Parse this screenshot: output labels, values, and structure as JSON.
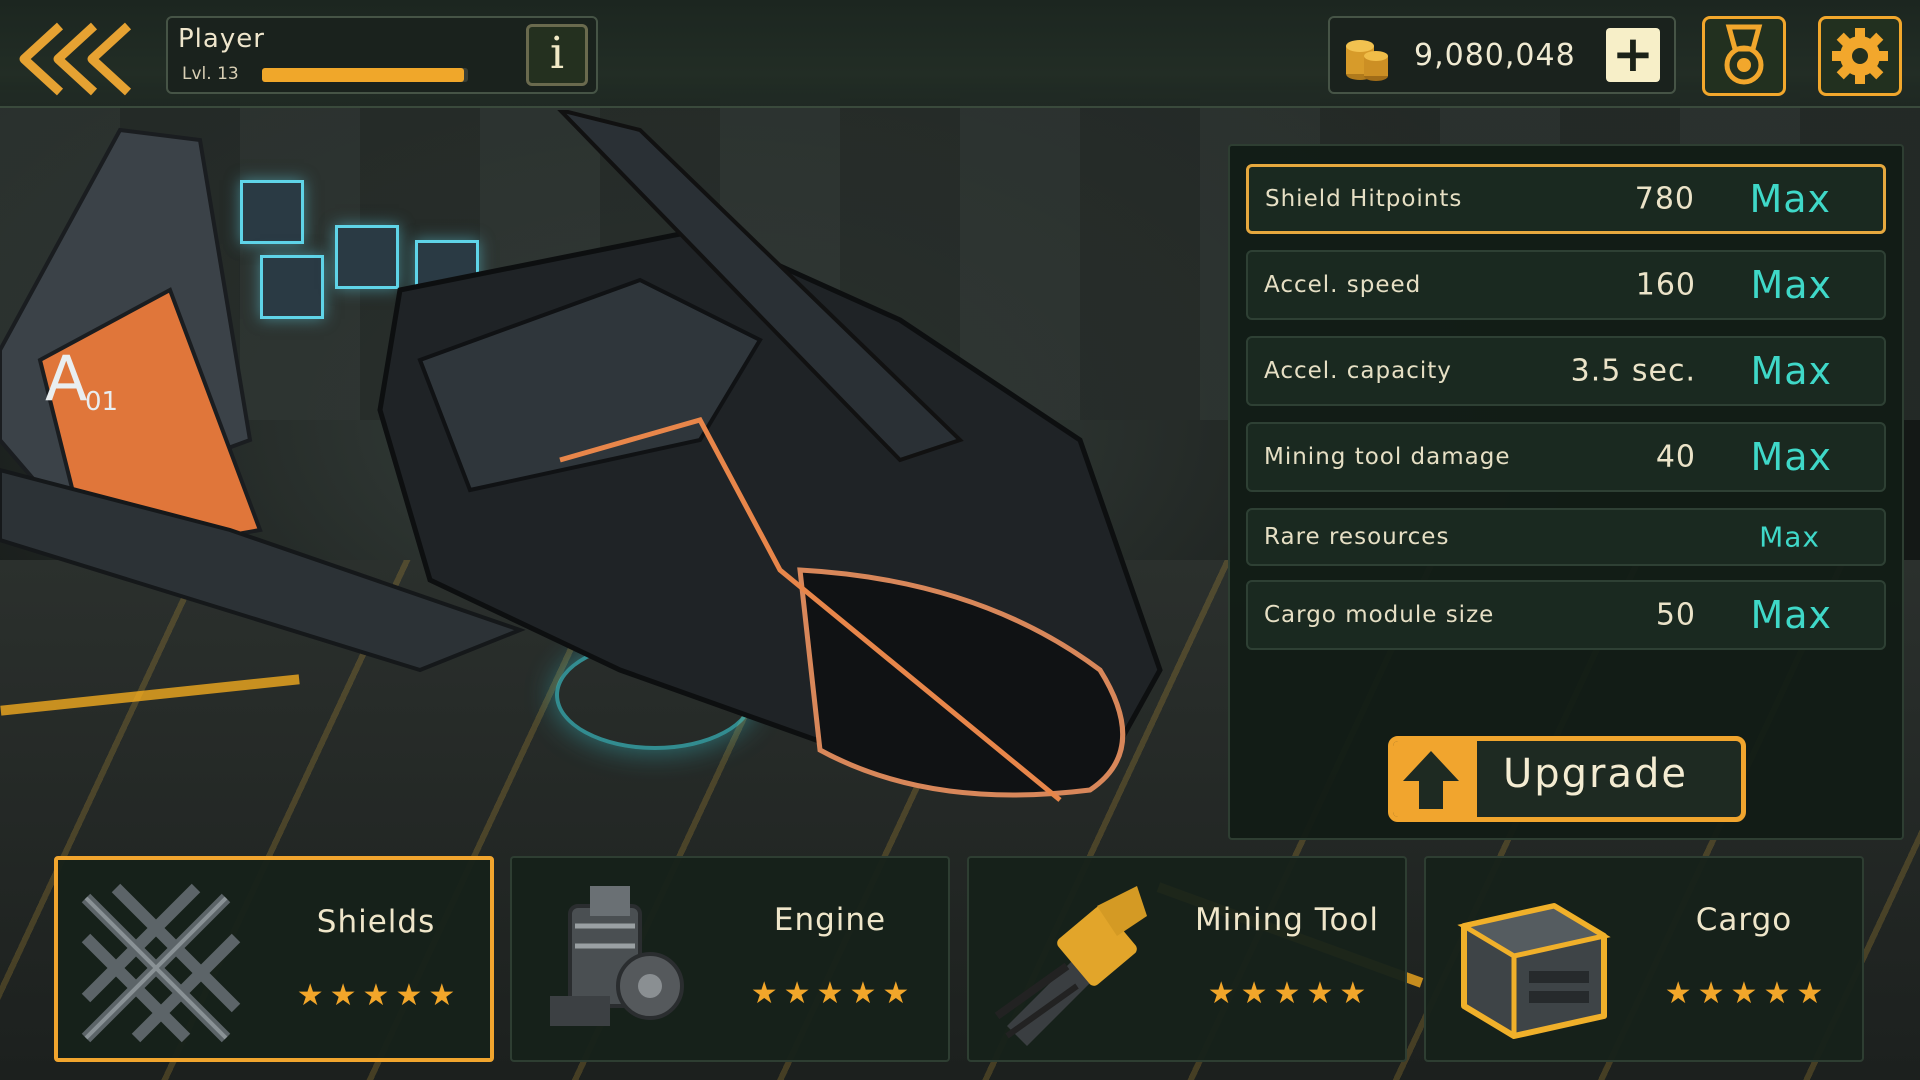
{
  "player": {
    "name": "Player",
    "level": "Lvl. 13",
    "xp_progress": 0.98
  },
  "currency": {
    "coins": "9,080,048",
    "icon": "coins-icon"
  },
  "header_icons": {
    "back": "double-chevron-left-icon",
    "info": "i",
    "add": "+",
    "medal": "medal-icon",
    "settings": "gear-icon"
  },
  "stats": [
    {
      "name": "Shield Hitpoints",
      "value": "780",
      "max": "Max",
      "selected": true
    },
    {
      "name": "Accel. speed",
      "value": "160",
      "max": "Max",
      "selected": false
    },
    {
      "name": "Accel. capacity",
      "value": "3.5 sec.",
      "max": "Max",
      "selected": false
    },
    {
      "name": "Mining tool damage",
      "value": "40",
      "max": "Max",
      "selected": false
    },
    {
      "name": "Rare resources",
      "value": "",
      "max": "Max",
      "selected": false
    },
    {
      "name": "Cargo module size",
      "value": "50",
      "max": "Max",
      "selected": false
    }
  ],
  "upgrade": {
    "label": "Upgrade",
    "icon": "arrow-up-icon"
  },
  "categories": [
    {
      "label": "Shields",
      "stars": 5,
      "max_stars": 5,
      "icon": "shield-mesh-icon",
      "selected": true
    },
    {
      "label": "Engine",
      "stars": 5,
      "max_stars": 5,
      "icon": "engine-icon",
      "selected": false
    },
    {
      "label": "Mining Tool",
      "stars": 5,
      "max_stars": 5,
      "icon": "mining-tool-icon",
      "selected": false
    },
    {
      "label": "Cargo",
      "stars": 5,
      "max_stars": 5,
      "icon": "cargo-crate-icon",
      "selected": false
    }
  ],
  "colors": {
    "accent_orange": "#f1a52e",
    "max_teal": "#3fd8c8",
    "panel_bg": "#121c16"
  }
}
